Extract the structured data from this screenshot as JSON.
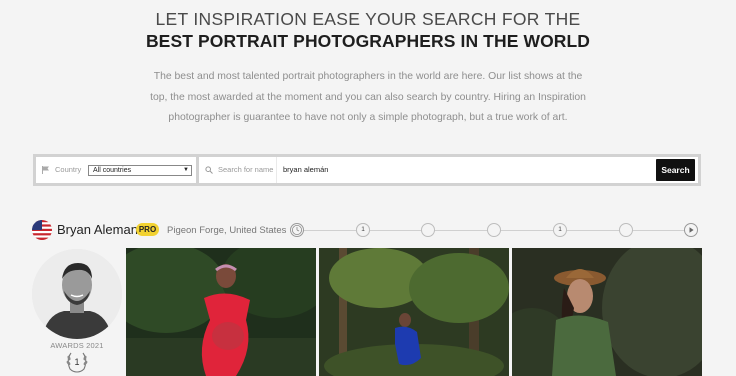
{
  "hero": {
    "line1": "LET INSPIRATION EASE YOUR SEARCH FOR THE",
    "line2": "BEST PORTRAIT PHOTOGRAPHERS IN THE WORLD",
    "intro": "The best and most talented portrait photographers in the world are here. Our list shows at the top, the most awarded at the moment and you can also search by country. Hiring an Inspiration photographer is guarantee to have not only a simple photograph, but a true work of art."
  },
  "search": {
    "country_label": "Country",
    "country_value": "All countries",
    "name_label": "Search for name",
    "name_value": "bryan alemán",
    "button_label": "Search"
  },
  "photographer": {
    "name": "Bryan Aleman",
    "badge": "PRO",
    "location": "Pigeon Forge, United States",
    "awards_label": "AWARDS 2021",
    "awards_count": "1",
    "timeline": [
      "",
      "1",
      "",
      "",
      "1",
      ""
    ],
    "photos": [
      "maternity-red-dress-photo",
      "maternity-blue-dress-forest-photo",
      "woman-hat-green-dress-photo"
    ]
  },
  "colors": {
    "pro_badge": "#f2d231",
    "button_bg": "#111111",
    "page_bg": "#f4f4f4"
  }
}
